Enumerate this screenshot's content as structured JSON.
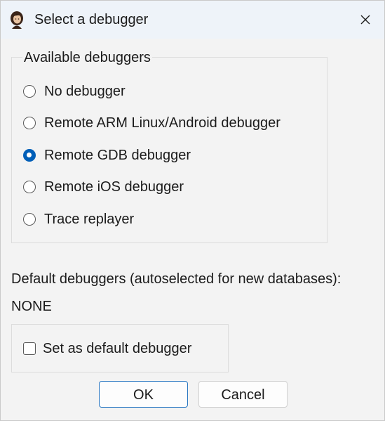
{
  "window": {
    "title": "Select a debugger",
    "app_icon": "ida-woman-portrait-icon",
    "close_icon": "close-icon"
  },
  "available": {
    "legend": "Available debuggers",
    "options": [
      {
        "label": "No debugger",
        "checked": false
      },
      {
        "label": "Remote ARM Linux/Android debugger",
        "checked": false
      },
      {
        "label": "Remote GDB debugger",
        "checked": true
      },
      {
        "label": "Remote iOS debugger",
        "checked": false
      },
      {
        "label": "Trace replayer",
        "checked": false
      }
    ]
  },
  "defaults": {
    "caption": "Default debuggers (autoselected for new databases):",
    "value": "NONE"
  },
  "set_default": {
    "label": "Set as default debugger",
    "checked": false
  },
  "buttons": {
    "ok": "OK",
    "cancel": "Cancel"
  },
  "colors": {
    "accent": "#005fb8",
    "titlebar": "#eef3f9",
    "background": "#f3f3f3"
  }
}
